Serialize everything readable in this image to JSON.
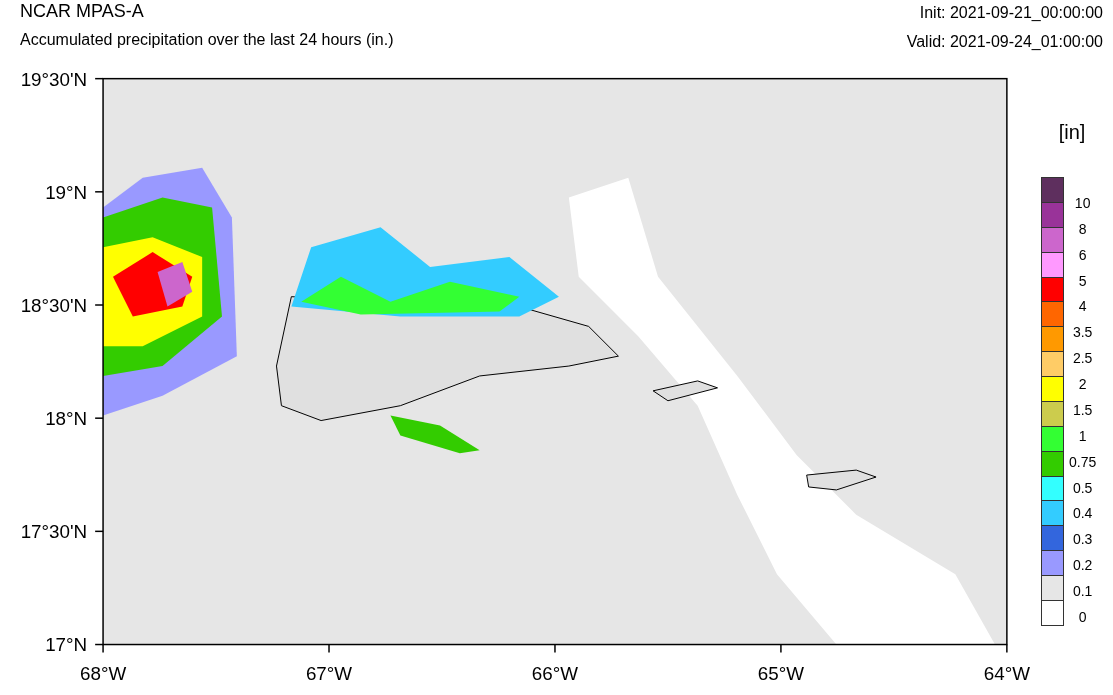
{
  "title": "NCAR MPAS-A",
  "subtitle": "Accumulated precipitation over the last 24 hours (in.)",
  "init": "Init: 2021-09-21_00:00:00",
  "valid": "Valid: 2021-09-24_01:00:00",
  "map": {
    "lat_ticks": [
      "19°30'N",
      "19°N",
      "18°30'N",
      "18°N",
      "17°30'N",
      "17°N"
    ],
    "lon_ticks": [
      "68°W",
      "67°W",
      "66°W",
      "65°W",
      "64°W"
    ]
  },
  "legend": {
    "title": "[in]",
    "bins": [
      {
        "color": "#5e2f5e"
      },
      {
        "color": "#993399"
      },
      {
        "color": "#cc66cc"
      },
      {
        "color": "#ff99ff"
      },
      {
        "color": "#ff0000"
      },
      {
        "color": "#ff6600"
      },
      {
        "color": "#ff9900"
      },
      {
        "color": "#ffcc66"
      },
      {
        "color": "#ffff00"
      },
      {
        "color": "#cccc4d"
      },
      {
        "color": "#33ff33"
      },
      {
        "color": "#33cc00"
      },
      {
        "color": "#33ffff"
      },
      {
        "color": "#33ccff"
      },
      {
        "color": "#3366dd"
      },
      {
        "color": "#9999ff"
      },
      {
        "color": "#e6e6e6"
      },
      {
        "color": "#ffffff"
      }
    ],
    "labels": [
      "10",
      "8",
      "6",
      "5",
      "4",
      "3.5",
      "2.5",
      "2",
      "1.5",
      "1",
      "0.75",
      "0.5",
      "0.4",
      "0.3",
      "0.2",
      "0.1",
      "0"
    ]
  }
}
